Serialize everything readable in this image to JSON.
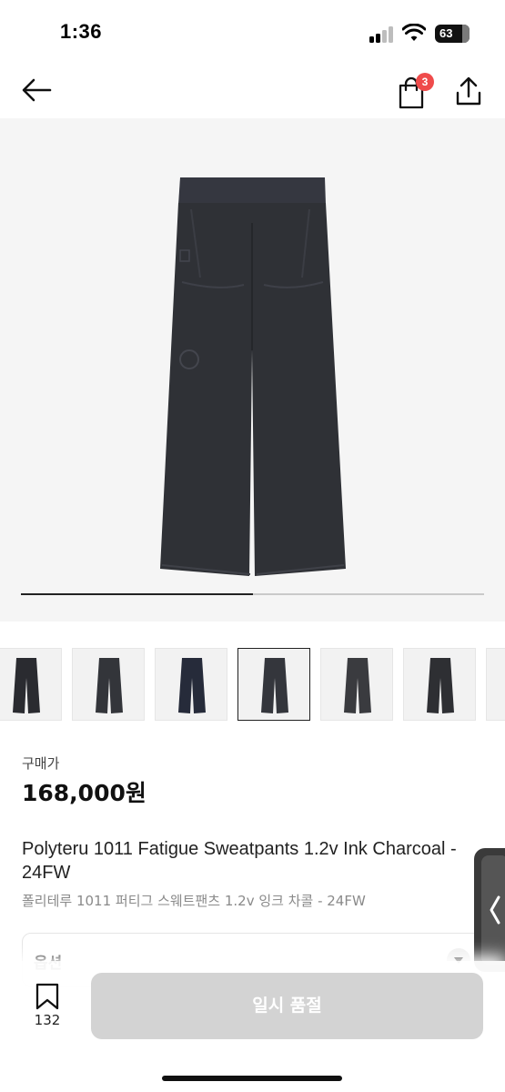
{
  "status_bar": {
    "time": "1:36",
    "battery": "63"
  },
  "nav": {
    "bag_count": "3"
  },
  "gallery": {
    "progress": 0.5,
    "thumbnail_count": 7,
    "selected_index": 3
  },
  "product": {
    "price_label": "구매가",
    "price": "168,000원",
    "title_en": "Polyteru 1011 Fatigue Sweatpants 1.2v Ink Charcoal - 24FW",
    "title_ko": "폴리테루 1011 퍼티그 스웨트팬츠 1.2v 잉크 차콜 - 24FW"
  },
  "option": {
    "label": "옵션"
  },
  "bottom_bar": {
    "bookmark_count": "132",
    "buy_label": "일시 품절"
  },
  "colors": {
    "badge": "#ef4b4b",
    "disabled_button": "#d3d3d3",
    "pants": "#2f3136"
  },
  "icons": [
    "back-arrow-icon",
    "shopping-bag-icon",
    "share-icon",
    "bookmark-icon",
    "chevron-down-icon",
    "chevron-left-icon"
  ]
}
